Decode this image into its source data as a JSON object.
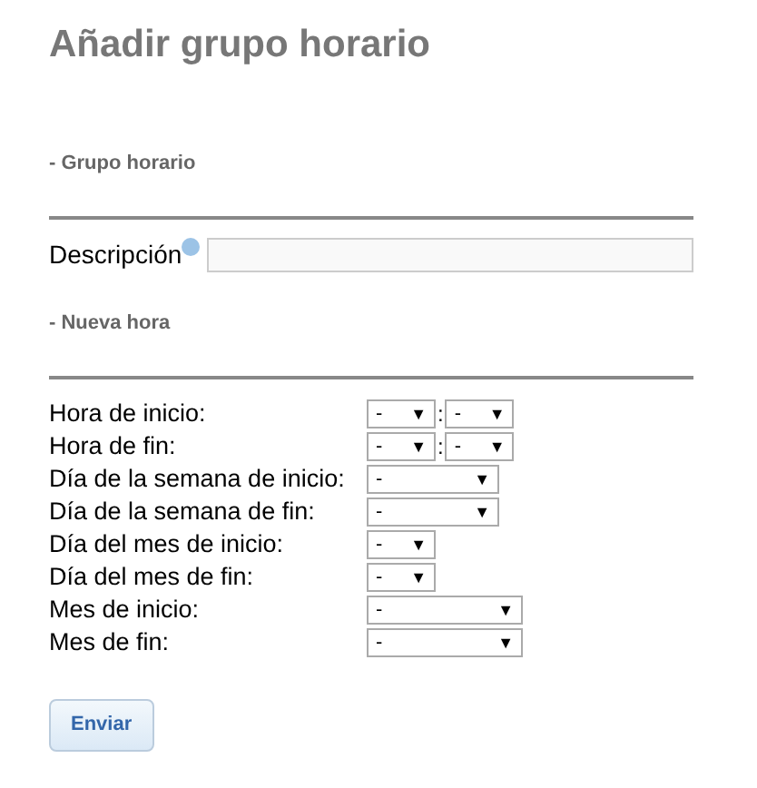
{
  "title": "Añadir grupo horario",
  "section_group": "- Grupo horario",
  "description": {
    "label": "Descripción",
    "help": true
  },
  "section_hour": "- Nueva hora",
  "rows": [
    {
      "label": "Hora de inicio:",
      "selects": [
        {
          "value": "-",
          "arrow": "▼",
          "kind": "hour"
        },
        {
          "value": "-",
          "arrow": "▼",
          "kind": "hour"
        }
      ],
      "separator": ":"
    },
    {
      "label": "Hora de fin:",
      "selects": [
        {
          "value": "-",
          "arrow": "▼",
          "kind": "hour"
        },
        {
          "value": "-",
          "arrow": "▼",
          "kind": "hour"
        }
      ],
      "separator": ":"
    },
    {
      "label": "Día de la semana de inicio:",
      "selects": [
        {
          "value": "-",
          "arrow": "▼",
          "kind": "weekday"
        }
      ]
    },
    {
      "label": "Día de la semana de fin:",
      "selects": [
        {
          "value": "-",
          "arrow": "▼",
          "kind": "weekday"
        }
      ]
    },
    {
      "label": "Día del mes de inicio:",
      "selects": [
        {
          "value": "-",
          "arrow": "▼",
          "kind": "day"
        }
      ]
    },
    {
      "label": "Día del mes de fin:",
      "selects": [
        {
          "value": "-",
          "arrow": "▼",
          "kind": "day"
        }
      ]
    },
    {
      "label": "Mes de inicio:",
      "selects": [
        {
          "value": "-",
          "arrow": "▼",
          "kind": "month"
        }
      ]
    },
    {
      "label": "Mes de fin:",
      "selects": [
        {
          "value": "-",
          "arrow": "▼",
          "kind": "month"
        }
      ]
    }
  ],
  "submit": "Enviar"
}
